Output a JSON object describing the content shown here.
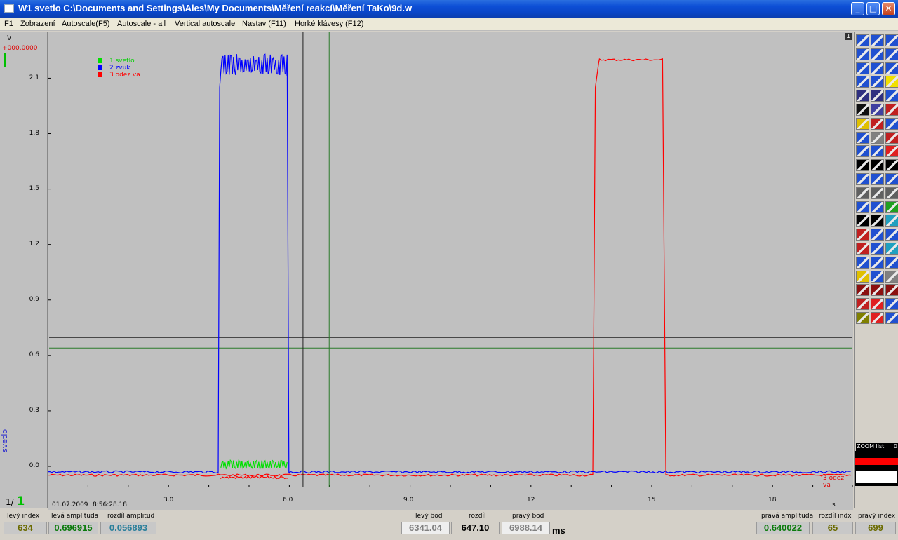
{
  "window": {
    "title": "W1 svetlo C:\\Documents and Settings\\Ales\\My Documents\\Měření reakcí\\Měření TaKo\\9d.w",
    "minimize": "_",
    "maximize": "□",
    "close": "✕"
  },
  "menu": [
    {
      "label": "F1"
    },
    {
      "label": "Zobrazení"
    },
    {
      "label": "Autoscale(F5)"
    },
    {
      "label": "Autoscale - all"
    },
    {
      "label": "Vertical autoscale"
    },
    {
      "label": "Nastav (F11)"
    },
    {
      "label": "Horké klávesy (F12)"
    }
  ],
  "plot": {
    "unit": "V",
    "base_value": "+000.0000",
    "y_axis_label": "svetlo",
    "page_indicator_prefix": "1/",
    "page_indicator_value": "1",
    "page_no": "1",
    "date": "01.07.2009",
    "time": "8:56:28.18",
    "x_unit": "s",
    "ms_unit": "ms",
    "series_end_label": "3 odez va",
    "zoom_label": "ZOOM list",
    "zoom_value": "0"
  },
  "chart_data": {
    "type": "line",
    "xlabel": "s",
    "ylabel": "svetlo",
    "xlim": [
      0,
      20
    ],
    "ylim": [
      -0.05,
      2.3
    ],
    "x_ticks": [
      "3.0",
      "6.0",
      "9.0",
      "12",
      "15",
      "18"
    ],
    "y_ticks": [
      "2.1",
      "1.8",
      "1.5",
      "1.2",
      "0.9",
      "0.6",
      "0.3",
      "0.0"
    ],
    "series": [
      {
        "name": "1 svetlo",
        "color": "#00e000",
        "x": [
          0,
          4.26,
          4.27,
          5.98,
          5.99,
          20
        ],
        "y": [
          0.0,
          0.0,
          0.02,
          0.02,
          0.0,
          0.0
        ]
      },
      {
        "name": "2 zvuk",
        "color": "#0000ff",
        "x": [
          0,
          4.25,
          4.27,
          5.97,
          5.99,
          20
        ],
        "y": [
          -0.03,
          -0.03,
          2.17,
          2.17,
          -0.03,
          -0.03
        ]
      },
      {
        "name": "3 odez va",
        "color": "#ff0000",
        "x": [
          0,
          13.55,
          13.65,
          15.3,
          15.35,
          20
        ],
        "y": [
          -0.04,
          -0.04,
          2.2,
          2.21,
          -0.04,
          -0.04
        ]
      }
    ],
    "cursors": {
      "vertical": [
        6.34,
        6.99
      ],
      "horizontal": [
        0.697,
        0.64
      ]
    }
  },
  "status": {
    "levy_index": {
      "label": "levý index",
      "value": "634"
    },
    "leva_amplituda": {
      "label": "levá amplituda",
      "value": "0.696915"
    },
    "rozdil_amplitud": {
      "label": "rozdíl amplitud",
      "value": "0.056893"
    },
    "levy_bod": {
      "label": "levý bod",
      "value": "6341.04"
    },
    "rozdil": {
      "label": "rozdíl",
      "value": "647.10"
    },
    "pravy_bod": {
      "label": "pravý bod",
      "value": "6988.14"
    },
    "prava_amplituda": {
      "label": "pravá amplituda",
      "value": "0.640022"
    },
    "rozdil_indx": {
      "label": "rozdíl indx",
      "value": "65"
    },
    "pravy_index": {
      "label": "pravý index",
      "value": "699"
    }
  },
  "colors": {
    "plot_bg": "#c0c0c0",
    "title_bar": "#0a46c8",
    "green_value": "#0a7a0a",
    "teal_value": "#2a7f9a",
    "olive_value": "#6b6b00"
  }
}
